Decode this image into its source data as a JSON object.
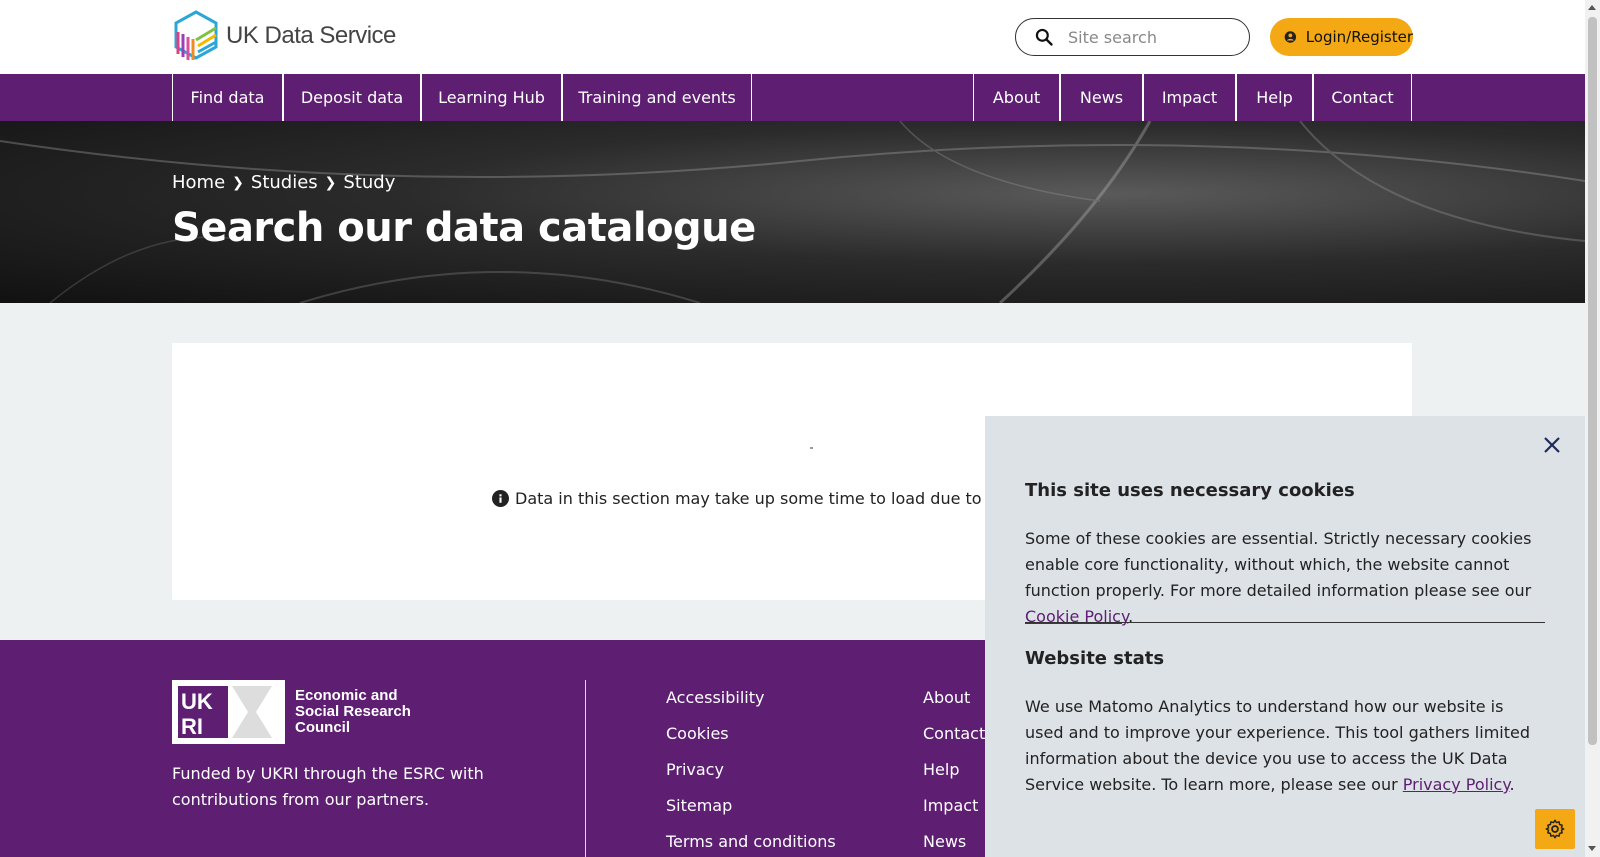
{
  "header": {
    "logo_text": "UK Data Service",
    "search_placeholder": "Site search",
    "login_label": "Login/Register"
  },
  "nav": {
    "left": [
      {
        "label": "Find data"
      },
      {
        "label": "Deposit data"
      },
      {
        "label": "Learning Hub"
      },
      {
        "label": "Training and events"
      }
    ],
    "right": [
      {
        "label": "About"
      },
      {
        "label": "News"
      },
      {
        "label": "Impact"
      },
      {
        "label": "Help"
      },
      {
        "label": "Contact"
      }
    ]
  },
  "breadcrumb": {
    "items": [
      {
        "label": "Home"
      },
      {
        "label": "Studies"
      },
      {
        "label": "Study"
      }
    ]
  },
  "hero": {
    "title": "Search our data catalogue"
  },
  "main": {
    "notice": "Data in this section may take up some time to load due to the"
  },
  "footer": {
    "esrc_logo_text": "Economic and Social Research Council",
    "funded_text": "Funded by UKRI through the ESRC with contributions from our partners.",
    "col1": [
      {
        "label": "Accessibility"
      },
      {
        "label": "Cookies"
      },
      {
        "label": "Privacy"
      },
      {
        "label": "Sitemap"
      },
      {
        "label": "Terms and conditions"
      }
    ],
    "col2": [
      {
        "label": "About"
      },
      {
        "label": "Contact"
      },
      {
        "label": "Help"
      },
      {
        "label": "Impact"
      },
      {
        "label": "News"
      }
    ]
  },
  "cookie_panel": {
    "necessary_title": "This site uses necessary cookies",
    "necessary_text": "Some of these cookies are essential. Strictly necessary cookies enable core functionality, without which, the website cannot function properly. For more detailed information please see our",
    "cookie_policy_link": "Cookie Policy",
    "stats_title": "Website stats",
    "stats_text": "We use Matomo Analytics to understand how our website is used and to improve your experience. This tool gathers limited information about the device you use to access the UK Data Service website. To learn more, please see our",
    "privacy_policy_link": "Privacy Policy"
  },
  "colors": {
    "brand_purple": "#5e1e72",
    "accent_yellow": "#f4a814",
    "cookie_panel_bg": "#dde2e6"
  },
  "icons": {
    "search": "search-icon",
    "user": "user-circle-icon",
    "close": "close-icon",
    "info": "info-icon",
    "settings": "gear-icon"
  }
}
